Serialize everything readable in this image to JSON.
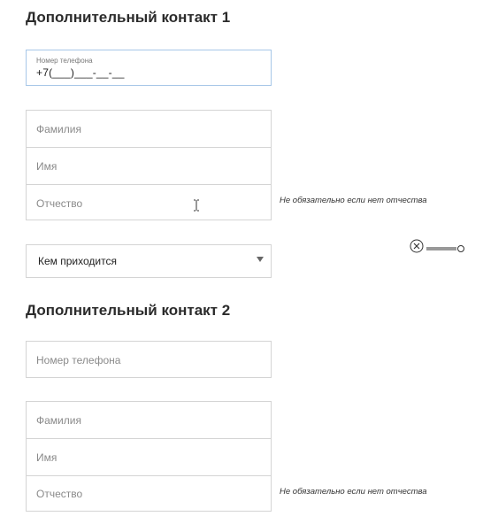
{
  "contact1": {
    "heading": "Дополнительный контакт 1",
    "phone_label": "Номер телефона",
    "phone_value": "+7(___)___-__-__",
    "last_name_placeholder": "Фамилия",
    "first_name_placeholder": "Имя",
    "middle_name_placeholder": "Отчество",
    "middle_name_hint": "Не обязательно если нет отчества",
    "relation_select": "Кем приходится"
  },
  "contact2": {
    "heading": "Дополнительный контакт 2",
    "phone_placeholder": "Номер телефона",
    "last_name_placeholder": "Фамилия",
    "first_name_placeholder": "Имя",
    "middle_name_placeholder": "Отчество",
    "middle_name_hint": "Не обязательно если нет отчества"
  },
  "icons": {
    "text_cursor": "text-cursor-icon",
    "remove": "close-circle-icon",
    "slider": "slider-handle-icon"
  }
}
